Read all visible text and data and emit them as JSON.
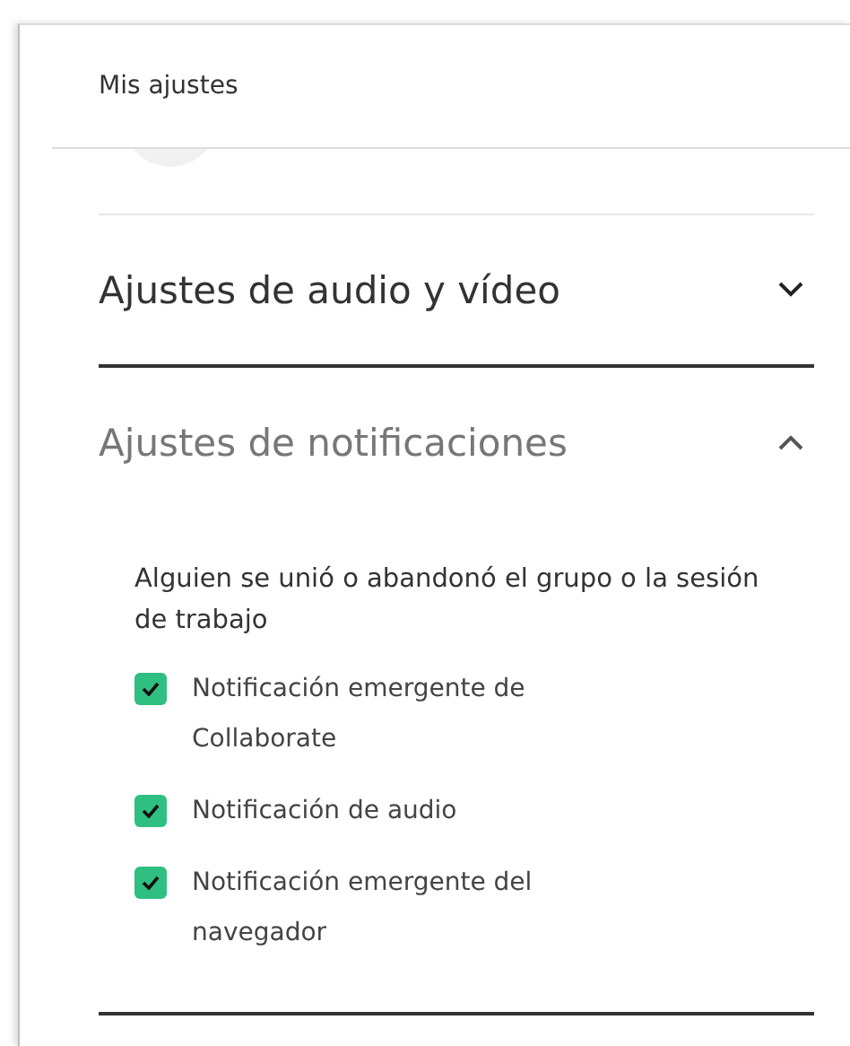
{
  "panel": {
    "title": "Mis ajustes"
  },
  "sections": [
    {
      "title": "Ajustes de audio y vídeo",
      "expanded": false
    },
    {
      "title": "Ajustes de notificaciones",
      "expanded": true,
      "group": "Alguien se unió o abandonó el grupo o la sesión de trabajo",
      "options": [
        {
          "label": "Notificación emergente de Collaborate",
          "checked": true
        },
        {
          "label": "Notificación de audio",
          "checked": true
        },
        {
          "label": "Notificación emergente del navegador",
          "checked": true
        }
      ]
    }
  ]
}
